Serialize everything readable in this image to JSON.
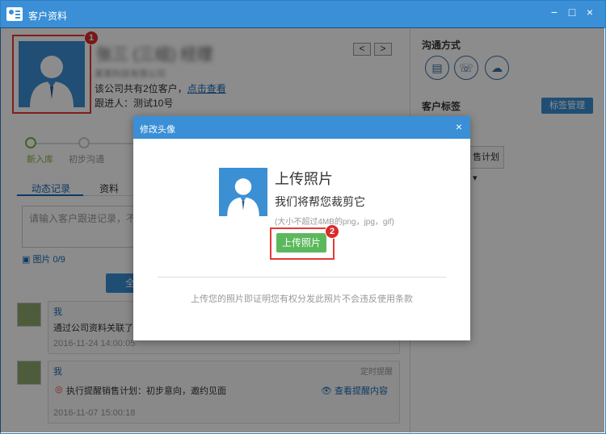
{
  "window": {
    "title": "客户资料",
    "minimize": "−",
    "maximize": "□",
    "close": "×"
  },
  "customer": {
    "name": "张三 (三组) 经理",
    "company": "某某科技有限公司",
    "company_count_text": "该公司共有2位客户，",
    "company_link": "点击查看",
    "follower": "跟进人：测试10号",
    "prev": "<",
    "next": ">"
  },
  "stages": [
    {
      "label": "新入库",
      "active": true
    },
    {
      "label": "初步沟通",
      "active": false
    }
  ],
  "tabs": [
    {
      "label": "动态记录",
      "active": true
    },
    {
      "label": "资料",
      "active": false
    }
  ],
  "record": {
    "placeholder": "请输入客户跟进记录，不超",
    "photo_count": "图片 0/9",
    "submit_label": "全"
  },
  "feed": [
    {
      "user": "我",
      "text": "通过公司资料关联了客户",
      "time": "2016-11-24 14:00:05"
    },
    {
      "user": "我",
      "tag": "定时提醒",
      "text": "执行提醒销售计划：初步意向，邀约见面",
      "link": "查看提醒内容",
      "time": "2016-11-07 15:00:18"
    }
  ],
  "right": {
    "contact_title": "沟通方式",
    "tags_title": "客户标签",
    "tags_button": "标签管理",
    "plan_dropdown": "售计划"
  },
  "modal": {
    "title": "修改头像",
    "close": "×",
    "heading": "上传照片",
    "subheading": "我们将帮您裁剪它",
    "hint": "(大小不超过4MB的png，jpg，gif)",
    "upload_button": "上传照片",
    "note": "上传您的照片即证明您有权分发此照片不会违反使用条款"
  },
  "callouts": {
    "one": "1",
    "two": "2"
  },
  "colors": {
    "brand": "#3a8fd6",
    "highlight": "#e53935",
    "upload": "#5cb85c"
  }
}
